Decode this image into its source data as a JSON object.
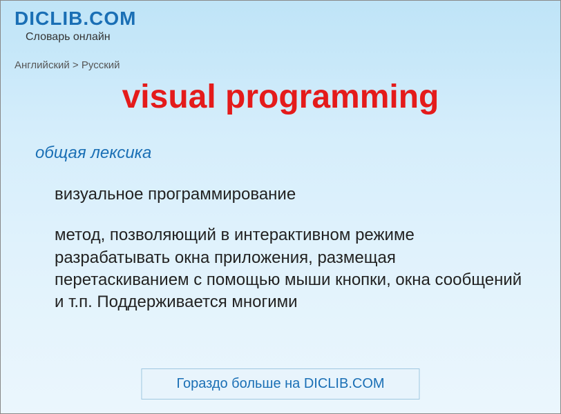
{
  "header": {
    "site_title": "DICLIB.COM",
    "site_subtitle": "Словарь онлайн"
  },
  "breadcrumb": "Английский > Русский",
  "main_title": "visual programming",
  "content": {
    "category_label": "общая лексика",
    "definition": "визуальное программирование",
    "description": "метод, позволяющий в интерактивном режиме разрабатывать окна приложения, размещая перетаскиванием с помощью мыши кнопки, окна сообщений и т.п. Поддерживается многими"
  },
  "footer": {
    "link_text": "Гораздо больше на DICLIB.COM"
  }
}
